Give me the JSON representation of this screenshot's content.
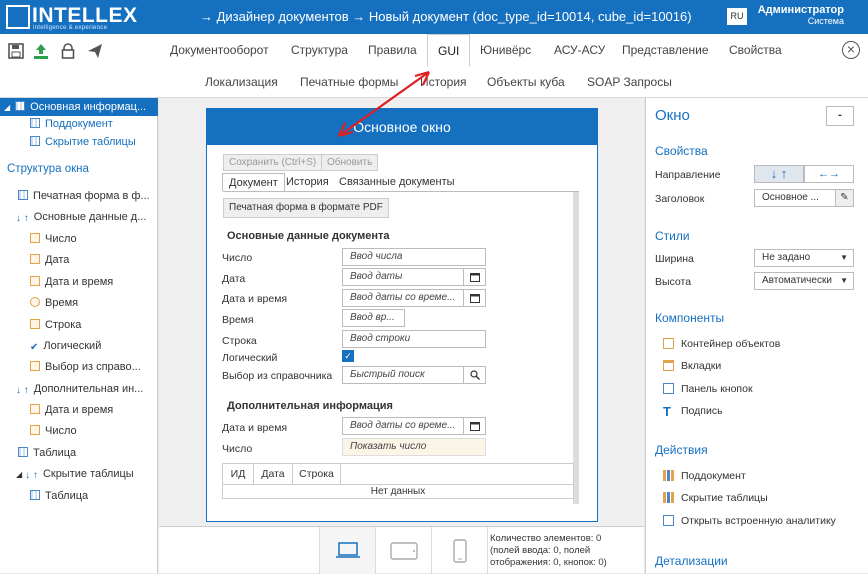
{
  "header": {
    "logo_text": "INTELLEX",
    "logo_subtitle": "intelligence & experience",
    "breadcrumb": "→ Дизайнер документов → Новый документ (doc_type_id=10014, cube_id=10016)",
    "lang": "RU",
    "user_name": "Администратор",
    "user_role": "Система"
  },
  "toolbar": {
    "icons": [
      "save-icon",
      "upload-icon",
      "lock-icon",
      "send-icon"
    ],
    "menu_row1": [
      "Документооборот",
      "Структура",
      "Правила",
      "GUI",
      "Юнивёрс",
      "АСУ-АСУ",
      "Представление",
      "Свойства"
    ],
    "menu_row2": [
      "Локализация",
      "Печатные формы",
      "История",
      "Объекты куба",
      "SOAP Запросы"
    ],
    "active_menu": "GUI"
  },
  "left": {
    "top_items": [
      "Основная информац...",
      "Поддокумент",
      "Скрытие таблицы"
    ],
    "section_title": "Структура окна",
    "tree": [
      "Печатная форма в ф...",
      "Основные данные д...",
      "Число",
      "Дата",
      "Дата и время",
      "Время",
      "Строка",
      "Логический",
      "Выбор из справо...",
      "Дополнительная ин...",
      "Дата и время",
      "Число",
      "Таблица",
      "Скрытие таблицы",
      "Таблица"
    ]
  },
  "window": {
    "title": "Основное окно",
    "save_btn": "Сохранить (Ctrl+S)",
    "refresh_btn": "Обновить",
    "tabs": [
      "Документ",
      "История",
      "Связанные документы"
    ],
    "pdf_btn": "Печатная форма в формате PDF",
    "section1": "Основные данные документа",
    "fields1": [
      {
        "label": "Число",
        "placeholder": "Ввод числа"
      },
      {
        "label": "Дата",
        "placeholder": "Ввод даты"
      },
      {
        "label": "Дата и время",
        "placeholder": "Ввод даты со време..."
      },
      {
        "label": "Время",
        "placeholder": "Ввод вр..."
      },
      {
        "label": "Строка",
        "placeholder": "Ввод строки"
      },
      {
        "label": "Логический",
        "placeholder": ""
      },
      {
        "label": "Выбор из справочника",
        "placeholder": "Быстрый поиск"
      }
    ],
    "section2": "Дополнительная информация",
    "fields2": [
      {
        "label": "Дата и время",
        "placeholder": "Ввод даты со време..."
      },
      {
        "label": "Число",
        "placeholder": "Показать число"
      }
    ],
    "table_headers": [
      "ИД",
      "Дата",
      "Строка"
    ],
    "table_empty": "Нет данных"
  },
  "bottom": {
    "stats_line1": "Количество элементов: 0",
    "stats_line2": "(полей ввода: 0, полей",
    "stats_line3": "отображения: 0, кнопок: 0)"
  },
  "right": {
    "title": "Окно",
    "collapse": "-",
    "props_title": "Свойства",
    "direction_label": "Направление",
    "header_label": "Заголовок",
    "header_value": "Основное ...",
    "styles_title": "Стили",
    "width_label": "Ширина",
    "width_value": "Не задано",
    "height_label": "Высота",
    "height_value": "Автоматически",
    "components_title": "Компоненты",
    "components": [
      "Контейнер объектов",
      "Вкладки",
      "Панель кнопок",
      "Подпись"
    ],
    "actions_title": "Действия",
    "actions": [
      "Поддокумент",
      "Скрытие таблицы",
      "Открыть встроенную аналитику"
    ],
    "details_title": "Детализации"
  },
  "colors": {
    "brand": "#1570c0",
    "annotation_arrow": "#e02020"
  }
}
